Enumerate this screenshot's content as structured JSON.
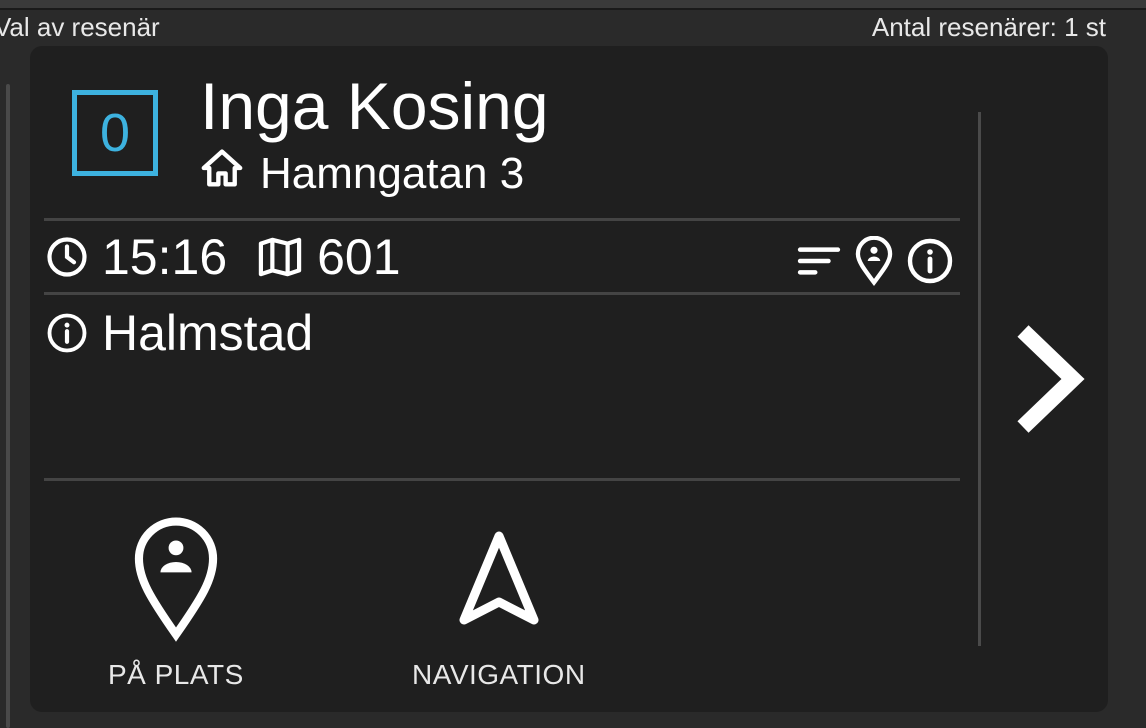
{
  "header": {
    "title": "Val av resenär",
    "count": "Antal resenärer: 1 st"
  },
  "card": {
    "badge": "0",
    "name": "Inga Kosing",
    "address": "Hamngatan 3",
    "time": "15:16",
    "map_code": "601",
    "info": "Halmstad"
  },
  "actions": {
    "on_site": "PÅ PLATS",
    "navigation": "NAVIGATION"
  },
  "colors": {
    "accent": "#3db2df",
    "card_bg": "#1f1f1f",
    "page_bg": "#2a2a2a"
  }
}
